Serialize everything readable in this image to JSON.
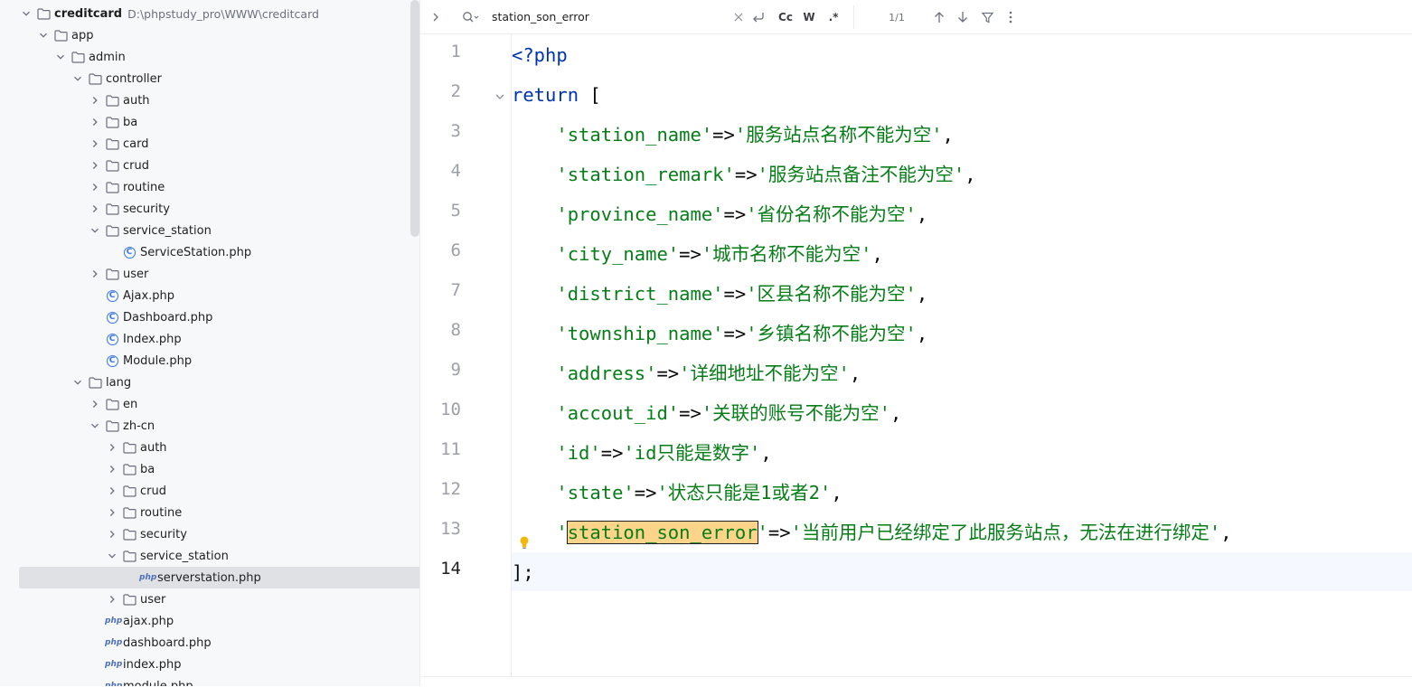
{
  "project_tree": [
    {
      "label": "creditcard",
      "hint": "D:\\phpstudy_pro\\WWW\\creditcard",
      "indent": 0,
      "type": "folder",
      "expanded": true,
      "bold": true
    },
    {
      "label": "app",
      "indent": 1,
      "type": "folder",
      "expanded": true
    },
    {
      "label": "admin",
      "indent": 2,
      "type": "folder",
      "expanded": true
    },
    {
      "label": "controller",
      "indent": 3,
      "type": "folder",
      "expanded": true
    },
    {
      "label": "auth",
      "indent": 4,
      "type": "folder",
      "expanded": false
    },
    {
      "label": "ba",
      "indent": 4,
      "type": "folder",
      "expanded": false
    },
    {
      "label": "card",
      "indent": 4,
      "type": "folder",
      "expanded": false
    },
    {
      "label": "crud",
      "indent": 4,
      "type": "folder",
      "expanded": false
    },
    {
      "label": "routine",
      "indent": 4,
      "type": "folder",
      "expanded": false
    },
    {
      "label": "security",
      "indent": 4,
      "type": "folder",
      "expanded": false
    },
    {
      "label": "service_station",
      "indent": 4,
      "type": "folder",
      "expanded": true
    },
    {
      "label": "ServiceStation.php",
      "indent": 5,
      "type": "class"
    },
    {
      "label": "user",
      "indent": 4,
      "type": "folder",
      "expanded": false
    },
    {
      "label": "Ajax.php",
      "indent": 4,
      "type": "class"
    },
    {
      "label": "Dashboard.php",
      "indent": 4,
      "type": "class"
    },
    {
      "label": "Index.php",
      "indent": 4,
      "type": "class"
    },
    {
      "label": "Module.php",
      "indent": 4,
      "type": "class"
    },
    {
      "label": "lang",
      "indent": 3,
      "type": "folder",
      "expanded": true
    },
    {
      "label": "en",
      "indent": 4,
      "type": "folder",
      "expanded": false
    },
    {
      "label": "zh-cn",
      "indent": 4,
      "type": "folder",
      "expanded": true
    },
    {
      "label": "auth",
      "indent": 5,
      "type": "folder",
      "expanded": false
    },
    {
      "label": "ba",
      "indent": 5,
      "type": "folder",
      "expanded": false
    },
    {
      "label": "crud",
      "indent": 5,
      "type": "folder",
      "expanded": false
    },
    {
      "label": "routine",
      "indent": 5,
      "type": "folder",
      "expanded": false
    },
    {
      "label": "security",
      "indent": 5,
      "type": "folder",
      "expanded": false
    },
    {
      "label": "service_station",
      "indent": 5,
      "type": "folder",
      "expanded": true
    },
    {
      "label": "serverstation.php",
      "indent": 6,
      "type": "php",
      "selected": true
    },
    {
      "label": "user",
      "indent": 5,
      "type": "folder",
      "expanded": false
    },
    {
      "label": "ajax.php",
      "indent": 4,
      "type": "php"
    },
    {
      "label": "dashboard.php",
      "indent": 4,
      "type": "php"
    },
    {
      "label": "index.php",
      "indent": 4,
      "type": "php"
    },
    {
      "label": "module.php",
      "indent": 4,
      "type": "php"
    }
  ],
  "search": {
    "query": "station_son_error",
    "match_count": "1/1",
    "case_label": "Cc",
    "word_label": "W",
    "regex_label": ".*"
  },
  "icons": {
    "php_label": "php",
    "class_letter": "C"
  },
  "editor": {
    "current_line": 14,
    "lines": [
      {
        "n": "1",
        "tokens": [
          {
            "t": "<?php",
            "c": "kw"
          }
        ]
      },
      {
        "n": "2",
        "fold": true,
        "tokens": [
          {
            "t": "return",
            "c": "kw"
          },
          {
            "t": " [",
            "c": "op"
          }
        ]
      },
      {
        "n": "3",
        "tokens": [
          {
            "t": "    ",
            "c": "op"
          },
          {
            "t": "'station_name'",
            "c": "str"
          },
          {
            "t": "=>",
            "c": "op"
          },
          {
            "t": "'服务站点名称不能为空'",
            "c": "str"
          },
          {
            "t": ",",
            "c": "op"
          }
        ]
      },
      {
        "n": "4",
        "tokens": [
          {
            "t": "    ",
            "c": "op"
          },
          {
            "t": "'station_remark'",
            "c": "str"
          },
          {
            "t": "=>",
            "c": "op"
          },
          {
            "t": "'服务站点备注不能为空'",
            "c": "str"
          },
          {
            "t": ",",
            "c": "op"
          }
        ]
      },
      {
        "n": "5",
        "tokens": [
          {
            "t": "    ",
            "c": "op"
          },
          {
            "t": "'province_name'",
            "c": "str"
          },
          {
            "t": "=>",
            "c": "op"
          },
          {
            "t": "'省份名称不能为空'",
            "c": "str"
          },
          {
            "t": ",",
            "c": "op"
          }
        ]
      },
      {
        "n": "6",
        "tokens": [
          {
            "t": "    ",
            "c": "op"
          },
          {
            "t": "'city_name'",
            "c": "str"
          },
          {
            "t": "=>",
            "c": "op"
          },
          {
            "t": "'城市名称不能为空'",
            "c": "str"
          },
          {
            "t": ",",
            "c": "op"
          }
        ]
      },
      {
        "n": "7",
        "tokens": [
          {
            "t": "    ",
            "c": "op"
          },
          {
            "t": "'district_name'",
            "c": "str"
          },
          {
            "t": "=>",
            "c": "op"
          },
          {
            "t": "'区县名称不能为空'",
            "c": "str"
          },
          {
            "t": ",",
            "c": "op"
          }
        ]
      },
      {
        "n": "8",
        "tokens": [
          {
            "t": "    ",
            "c": "op"
          },
          {
            "t": "'township_name'",
            "c": "str"
          },
          {
            "t": "=>",
            "c": "op"
          },
          {
            "t": "'乡镇名称不能为空'",
            "c": "str"
          },
          {
            "t": ",",
            "c": "op"
          }
        ]
      },
      {
        "n": "9",
        "tokens": [
          {
            "t": "    ",
            "c": "op"
          },
          {
            "t": "'address'",
            "c": "str"
          },
          {
            "t": "=>",
            "c": "op"
          },
          {
            "t": "'详细地址不能为空'",
            "c": "str"
          },
          {
            "t": ",",
            "c": "op"
          }
        ]
      },
      {
        "n": "10",
        "tokens": [
          {
            "t": "    ",
            "c": "op"
          },
          {
            "t": "'accout_id'",
            "c": "str"
          },
          {
            "t": "=>",
            "c": "op"
          },
          {
            "t": "'关联的账号不能为空'",
            "c": "str"
          },
          {
            "t": ",",
            "c": "op"
          }
        ]
      },
      {
        "n": "11",
        "tokens": [
          {
            "t": "    ",
            "c": "op"
          },
          {
            "t": "'id'",
            "c": "str"
          },
          {
            "t": "=>",
            "c": "op"
          },
          {
            "t": "'id只能是数字'",
            "c": "str"
          },
          {
            "t": ",",
            "c": "op"
          }
        ]
      },
      {
        "n": "12",
        "tokens": [
          {
            "t": "    ",
            "c": "op"
          },
          {
            "t": "'state'",
            "c": "str"
          },
          {
            "t": "=>",
            "c": "op"
          },
          {
            "t": "'状态只能是1或者2'",
            "c": "str"
          },
          {
            "t": ",",
            "c": "op"
          }
        ]
      },
      {
        "n": "13",
        "bulb": true,
        "tokens": [
          {
            "t": "    ",
            "c": "op"
          },
          {
            "t": "'",
            "c": "str"
          },
          {
            "t": "station_son_error",
            "c": "str match"
          },
          {
            "t": "'",
            "c": "str"
          },
          {
            "t": "=>",
            "c": "op"
          },
          {
            "t": "'当前用户已经绑定了此服务站点，无法在进行绑定'",
            "c": "str"
          },
          {
            "t": ",",
            "c": "op"
          }
        ]
      },
      {
        "n": "14",
        "tokens": [
          {
            "t": "];",
            "c": "op"
          }
        ]
      }
    ]
  }
}
